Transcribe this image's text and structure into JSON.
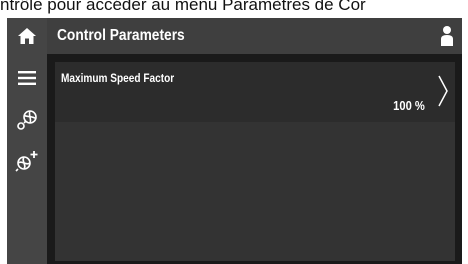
{
  "caption": "ntrôle pour accéder au menu Paramètres de Cor",
  "header": {
    "title": "Control Parameters"
  },
  "sidebar": {
    "items": [
      {
        "icon": "home-icon"
      },
      {
        "icon": "menu-icon"
      },
      {
        "icon": "fan-settings-icon"
      },
      {
        "icon": "fan-add-icon"
      }
    ]
  },
  "parameters": [
    {
      "label": "Maximum Speed Factor",
      "value": "100 %"
    }
  ],
  "colors": {
    "sidebar": "#454545",
    "topbar": "#3f3f3f",
    "content": "#333333",
    "row": "#2c2c2c",
    "text": "#ffffff"
  }
}
